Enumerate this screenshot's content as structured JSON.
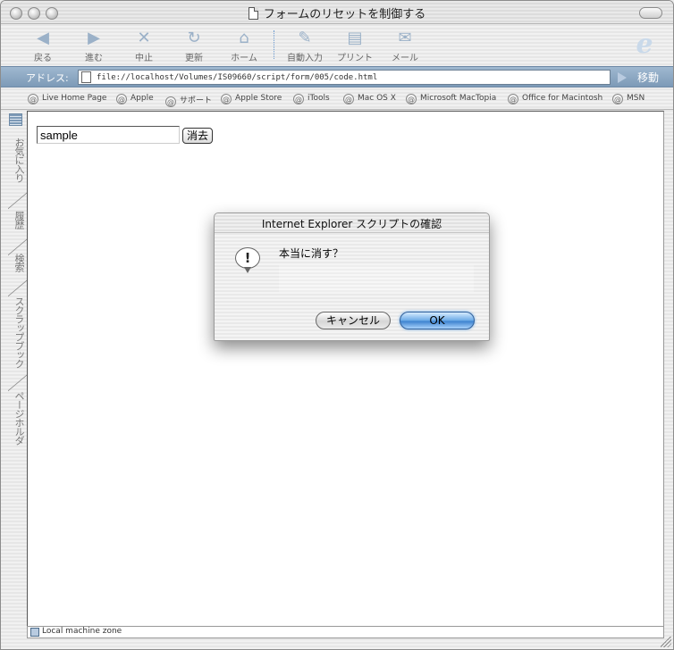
{
  "window": {
    "title": "フォームのリセットを制御する"
  },
  "toolbar": {
    "buttons": [
      {
        "label": "戻る",
        "icon": "back-arrow-icon"
      },
      {
        "label": "進む",
        "icon": "forward-arrow-icon"
      },
      {
        "label": "中止",
        "icon": "stop-x-icon"
      },
      {
        "label": "更新",
        "icon": "refresh-icon"
      },
      {
        "label": "ホーム",
        "icon": "home-icon"
      },
      {
        "label": "自動入力",
        "icon": "autofill-icon"
      },
      {
        "label": "プリント",
        "icon": "printer-icon"
      },
      {
        "label": "メール",
        "icon": "mail-icon"
      }
    ]
  },
  "address": {
    "label": "アドレス:",
    "url": "file://localhost/Volumes/IS09660/script/form/005/code.html",
    "go_label": "移動"
  },
  "favorites": [
    "Live Home Page",
    "Apple",
    "サポート",
    "Apple Store",
    "iTools",
    "Mac OS X",
    "Microsoft MacTopia",
    "Office for Macintosh",
    "MSN"
  ],
  "sidebar": {
    "tabs": [
      "お気に入り",
      "履歴",
      "検索",
      "スクラップブック",
      "ページホルダ"
    ]
  },
  "page": {
    "input_value": "sample",
    "clear_button": "消去"
  },
  "dialog": {
    "title": "Internet Explorer スクリプトの確認",
    "message": "本当に消す？",
    "cancel_label": "キャンセル",
    "ok_label": "OK"
  },
  "status": {
    "zone": "Local machine zone"
  },
  "colors": {
    "address_bar": "#7d9ab7",
    "ok_button": "#3d82cf"
  }
}
